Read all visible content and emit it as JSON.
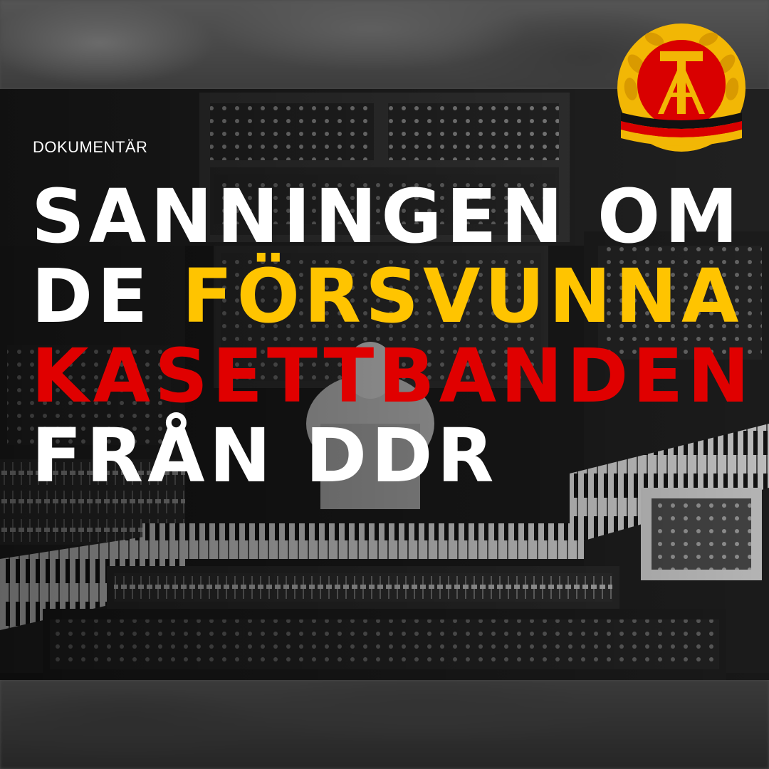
{
  "kicker": "DOKUMENTÄR",
  "headline": {
    "line1": "SANNINGEN OM",
    "line2_white": "DE ",
    "line2_yellow": "FÖRSVUNNA",
    "line3_red": "KASETTBANDEN",
    "line4": "FRÅN DDR"
  },
  "colors": {
    "white": "#ffffff",
    "yellow": "#ffc400",
    "red": "#e00000",
    "emblem_gold": "#f2b705",
    "emblem_red": "#d90000"
  },
  "emblem": {
    "icon": "ddr-emblem-icon"
  },
  "background": {
    "subject": "synthesizer-studio-photo"
  }
}
